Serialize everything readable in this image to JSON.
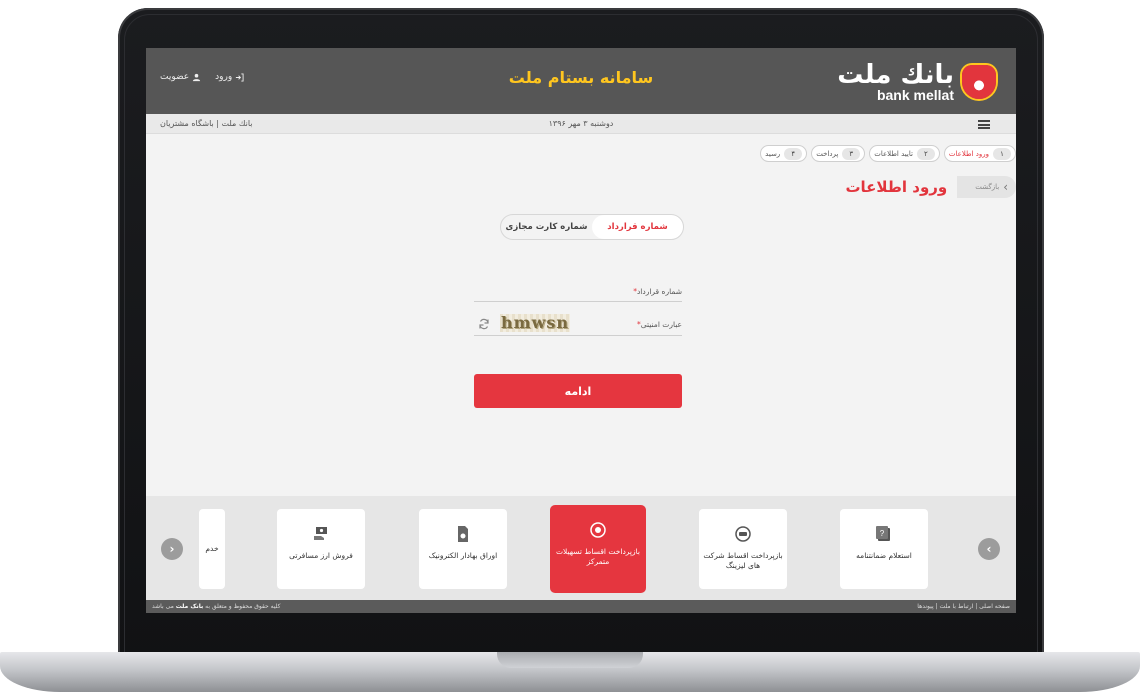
{
  "header": {
    "site_title": "سامانه بستام ملت",
    "logo_fa": "بانك ملت",
    "logo_en": "bank mellat",
    "login": "ورود",
    "register": "عضویت"
  },
  "subbar": {
    "date": "دوشنبه ۳ مهر ۱۳۹۶",
    "links": "بانك ملت | باشگاه مشتریان"
  },
  "steps": [
    {
      "num": "۱",
      "label": "ورود اطلاعات"
    },
    {
      "num": "۲",
      "label": "تایید اطلاعات"
    },
    {
      "num": "۳",
      "label": "پرداخت"
    },
    {
      "num": "۴",
      "label": "رسید"
    }
  ],
  "page": {
    "back": "بازگشت",
    "title": "ورود اطلاعات"
  },
  "toggle": {
    "contract": "شماره قرارداد",
    "virtual_card": "شماره کارت مجازی"
  },
  "form": {
    "contract_label": "شماره قرارداد",
    "captcha_label": "عبارت امنیتی",
    "required_mark": "*",
    "captcha_text": "hmwsn",
    "submit": "ادامه"
  },
  "services": [
    {
      "label": "استعلام ضمانتنامه",
      "icon": "document-question-icon"
    },
    {
      "label": "بازپرداخت اقساط شرکت های لیزینگ",
      "icon": "car-payment-icon"
    },
    {
      "label": "بازپرداخت اقساط تسهیلات متمرکز",
      "icon": "refresh-money-icon"
    },
    {
      "label": "اوراق بهادار الکترونیک",
      "icon": "securities-document-icon"
    },
    {
      "label": "فروش ارز مسافرتی",
      "icon": "currency-hand-icon"
    },
    {
      "label": "خدم",
      "icon": ""
    }
  ],
  "footer": {
    "right": "صفحه اصلی | ارتباط با ملت | پیوندها",
    "left_prefix": "کلیه حقوق محفوظ و متعلق به",
    "left_brand": "بانک ملت",
    "left_suffix": "می باشد"
  },
  "colors": {
    "accent": "#e5363f",
    "header": "#565656",
    "title": "#ffc61f"
  }
}
